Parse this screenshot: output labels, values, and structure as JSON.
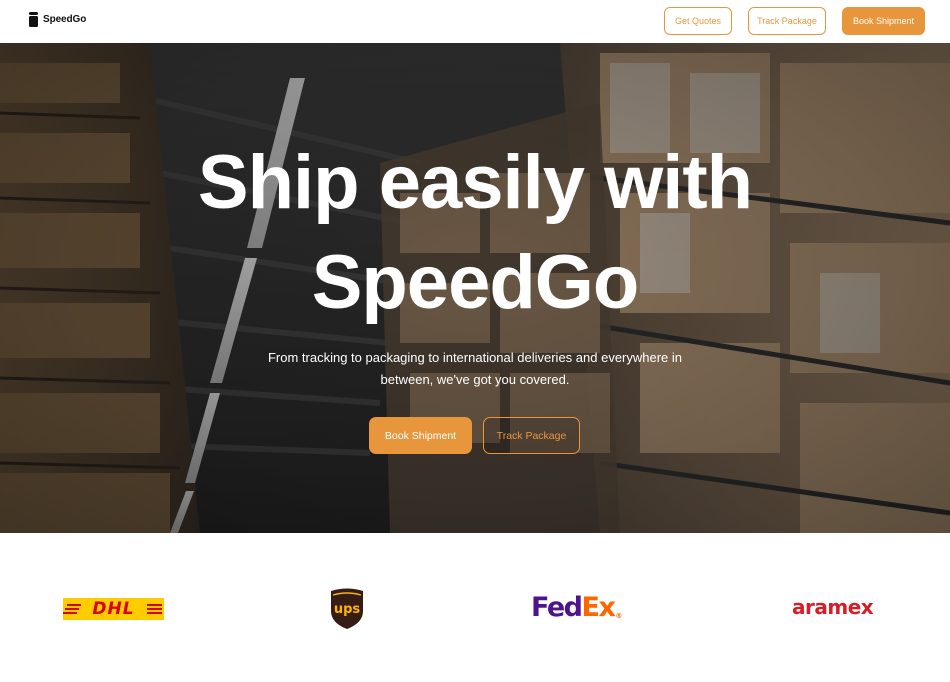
{
  "brand": {
    "name": "SpeedGo",
    "icon": "speedgo-logo-icon"
  },
  "nav": {
    "get_quotes": "Get Quotes",
    "track_package": "Track Package",
    "book_shipment": "Book Shipment"
  },
  "hero": {
    "title_line1": "Ship easily with",
    "title_line2": "SpeedGo",
    "subtitle_line1": "From tracking to packaging to international deliveries and everywhere in",
    "subtitle_line2": "between, we've got you covered.",
    "primary_cta": "Book Shipment",
    "secondary_cta": "Track Package",
    "background": "warehouse-shelves-photo"
  },
  "partners": {
    "dhl": "DHL",
    "ups": "ups",
    "fedex_fed": "Fed",
    "fedex_ex": "Ex",
    "fedex_reg": "®",
    "aramex": "aramex"
  },
  "colors": {
    "accent": "#E8963C",
    "dhl_yellow": "#FFCC00",
    "dhl_red": "#D40511",
    "ups_brown": "#351C15",
    "ups_gold": "#FFB500",
    "fedex_purple": "#4D148C",
    "fedex_orange": "#FF6600",
    "aramex_red": "#D71E28"
  }
}
